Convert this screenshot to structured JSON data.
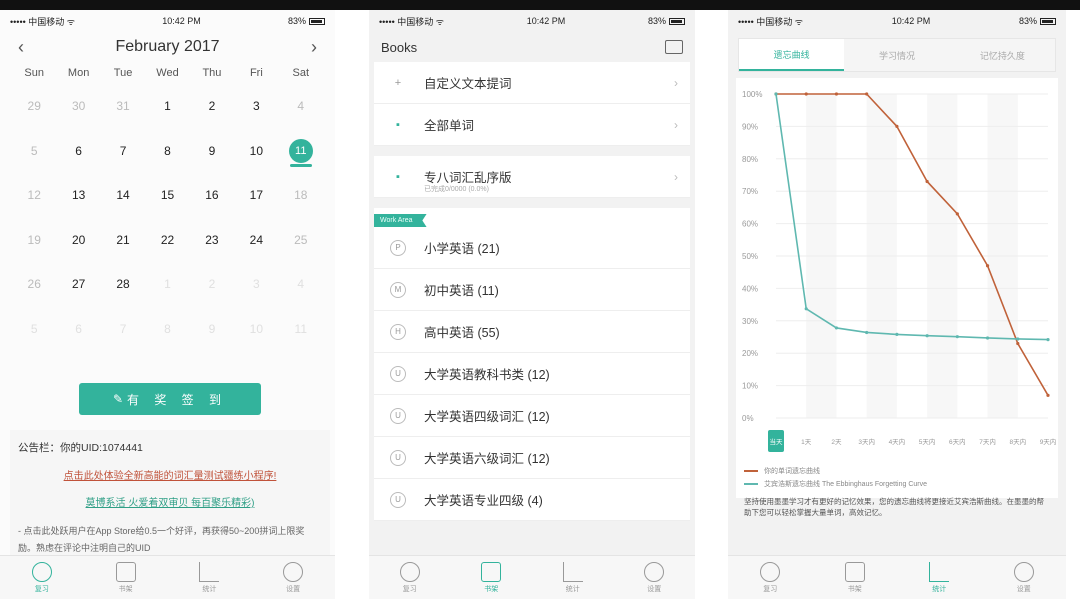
{
  "screen1": {
    "status": {
      "carrier": "••••• 中国移动 ᯤ",
      "time": "10:42 PM",
      "battery": "83%"
    },
    "calendar": {
      "month_title": "February 2017",
      "prev": "‹",
      "next": "›",
      "weekdays": [
        "Sun",
        "Mon",
        "Tue",
        "Wed",
        "Thu",
        "Fri",
        "Sat"
      ],
      "days": [
        {
          "n": "29",
          "s": "dim"
        },
        {
          "n": "30",
          "s": "dim"
        },
        {
          "n": "31",
          "s": "dim"
        },
        {
          "n": "1",
          "s": ""
        },
        {
          "n": "2",
          "s": ""
        },
        {
          "n": "3",
          "s": ""
        },
        {
          "n": "4",
          "s": "dim"
        },
        {
          "n": "5",
          "s": "dim"
        },
        {
          "n": "6",
          "s": ""
        },
        {
          "n": "7",
          "s": ""
        },
        {
          "n": "8",
          "s": ""
        },
        {
          "n": "9",
          "s": ""
        },
        {
          "n": "10",
          "s": ""
        },
        {
          "n": "11",
          "s": "today"
        },
        {
          "n": "12",
          "s": "dim"
        },
        {
          "n": "13",
          "s": ""
        },
        {
          "n": "14",
          "s": ""
        },
        {
          "n": "15",
          "s": ""
        },
        {
          "n": "16",
          "s": ""
        },
        {
          "n": "17",
          "s": ""
        },
        {
          "n": "18",
          "s": "dim"
        },
        {
          "n": "19",
          "s": "dim"
        },
        {
          "n": "20",
          "s": ""
        },
        {
          "n": "21",
          "s": ""
        },
        {
          "n": "22",
          "s": ""
        },
        {
          "n": "23",
          "s": ""
        },
        {
          "n": "24",
          "s": ""
        },
        {
          "n": "25",
          "s": "dim"
        },
        {
          "n": "26",
          "s": "dim"
        },
        {
          "n": "27",
          "s": ""
        },
        {
          "n": "28",
          "s": ""
        },
        {
          "n": "1",
          "s": "faint"
        },
        {
          "n": "2",
          "s": "faint"
        },
        {
          "n": "3",
          "s": "faint"
        },
        {
          "n": "4",
          "s": "faint"
        },
        {
          "n": "5",
          "s": "faint"
        },
        {
          "n": "6",
          "s": "faint"
        },
        {
          "n": "7",
          "s": "faint"
        },
        {
          "n": "8",
          "s": "faint"
        },
        {
          "n": "9",
          "s": "faint"
        },
        {
          "n": "10",
          "s": "faint"
        },
        {
          "n": "11",
          "s": "faint"
        }
      ]
    },
    "signin_label": "有 奖 签 到",
    "notice": {
      "line1": "公告栏：你的UID:1074441",
      "line2": "点击此处体验全新高能的词汇量测试疆练小程序!",
      "line3": "莫博系活 火爱着双审贝 每百聚乐精彩)",
      "line4": "- 点击此处跃用户在App Store给0.5一个好评，再获得50~200拼词上限奖励。熟虑在评论中注明自己的UID"
    },
    "tabs": [
      "复习",
      "书架",
      "统计",
      "设置"
    ],
    "active_tab": 0
  },
  "screen2": {
    "status": {
      "carrier": "••••• 中国移动 ᯤ",
      "time": "10:42 PM",
      "battery": "83%"
    },
    "title": "Books",
    "top_rows": [
      {
        "icon": "+",
        "label": "自定义文本提词"
      },
      {
        "icon": "▪",
        "label": "全部单词"
      }
    ],
    "special_row": {
      "icon": "▪",
      "label": "专八词汇乱序版",
      "sub": "已完成0/0000 (0.0%)"
    },
    "ribbon": "Work Area",
    "book_rows": [
      {
        "icon": "P",
        "label": "小学英语 (21)"
      },
      {
        "icon": "M",
        "label": "初中英语 (11)"
      },
      {
        "icon": "H",
        "label": "高中英语 (55)"
      },
      {
        "icon": "U",
        "label": "大学英语教科书类 (12)"
      },
      {
        "icon": "U",
        "label": "大学英语四级词汇 (12)"
      },
      {
        "icon": "U",
        "label": "大学英语六级词汇 (12)"
      },
      {
        "icon": "U",
        "label": "大学英语专业四级 (4)"
      }
    ],
    "tabs": [
      "复习",
      "书架",
      "统计",
      "设置"
    ],
    "active_tab": 1
  },
  "screen3": {
    "status": {
      "carrier": "••••• 中国移动 ᯤ",
      "time": "10:42 PM",
      "battery": "83%"
    },
    "segments": [
      "遗忘曲线",
      "学习情况",
      "记忆持久度"
    ],
    "active_segment": 0,
    "legend": [
      {
        "label": "你的单词遗忘曲线",
        "color": "#c0623a"
      },
      {
        "label": "艾宾浩斯遗忘曲线 The Ebbinghaus Forgetting Curve",
        "color": "#5fb8b0"
      }
    ],
    "note": "坚持使用墨墨学习才有更好的记忆效果，您的遗忘曲线将更接近艾宾浩斯曲线。在墨墨的帮助下您可以轻松掌握大量单词，高效记忆。",
    "tabs": [
      "复习",
      "书架",
      "统计",
      "设置"
    ],
    "active_tab": 2,
    "chart_data": {
      "type": "line",
      "categories": [
        "当天",
        "1天",
        "2天",
        "3天",
        "4天",
        "5天",
        "6天",
        "7天",
        "8天",
        "9天"
      ],
      "x_tick_labels": [
        "当天",
        "1天",
        "2天",
        "3天内",
        "4天内",
        "5天内",
        "6天内",
        "7天内",
        "8天内",
        "9天内"
      ],
      "y_ticks": [
        "0%",
        "10%",
        "20%",
        "30%",
        "40%",
        "50%",
        "60%",
        "70%",
        "80%",
        "90%",
        "100%"
      ],
      "ylim": [
        0,
        100
      ],
      "series": [
        {
          "name": "你的单词遗忘曲线",
          "color": "#c0623a",
          "values": [
            100,
            100,
            100,
            100,
            90,
            73,
            63,
            47,
            23,
            7
          ]
        },
        {
          "name": "艾宾浩斯遗忘曲线 The Ebbinghaus Forgetting Curve",
          "color": "#5fb8b0",
          "values": [
            100,
            33.7,
            27.8,
            26.4,
            25.8,
            25.4,
            25.1,
            24.7,
            24.4,
            24.2
          ]
        }
      ]
    }
  }
}
